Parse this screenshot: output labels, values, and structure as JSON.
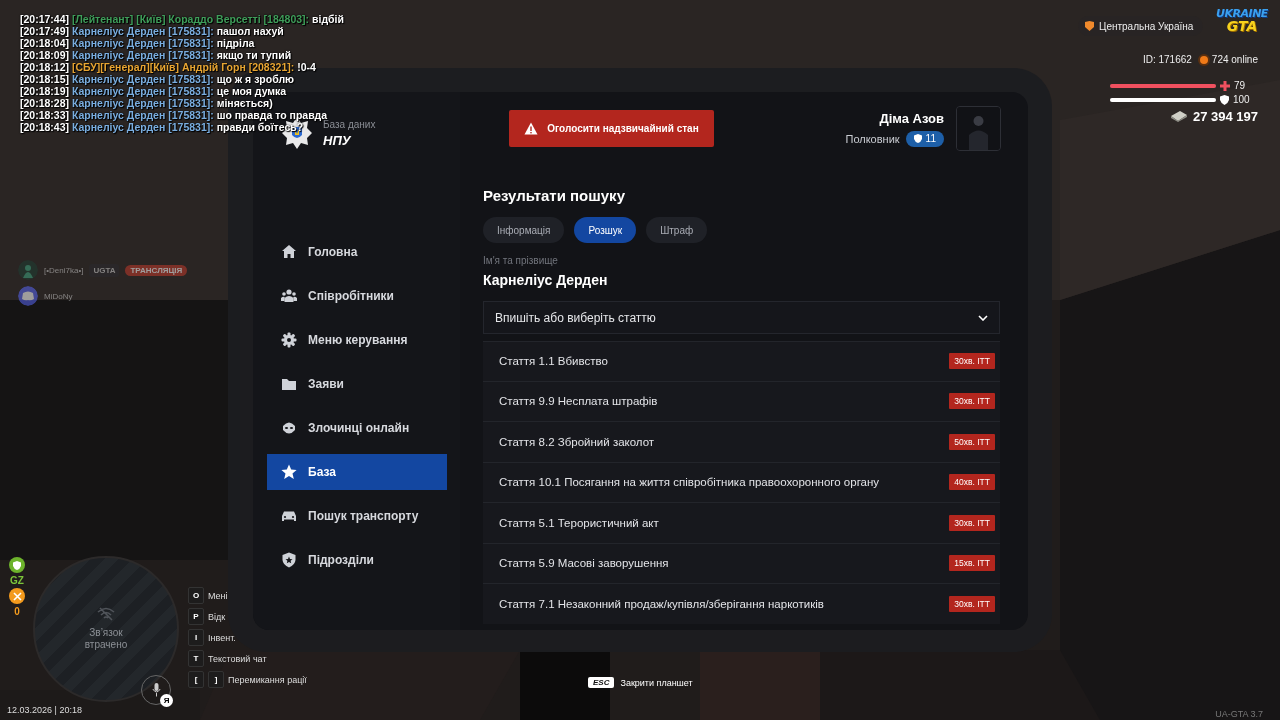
{
  "chat": [
    {
      "time": "[20:17:44]",
      "sender": "[Лейтенант] [Київ]  Кораддо Версетті [184803]:",
      "message": "відбій",
      "color": "#3f9e5a"
    },
    {
      "time": "[20:17:49]",
      "sender": "Карнеліус Дерден [175831]:",
      "message": "пашол нахуй",
      "color": "#7aaee0"
    },
    {
      "time": "[20:18:04]",
      "sender": "Карнеліус Дерден [175831]:",
      "message": "підріла",
      "color": "#7aaee0"
    },
    {
      "time": "[20:18:09]",
      "sender": "Карнеліус Дерден [175831]:",
      "message": "якщо ти тупий",
      "color": "#7aaee0"
    },
    {
      "time": "[20:18:12]",
      "sender": "[СБУ][Генерал][Київ] Андрій Горн [208321]:",
      "message": "!0-4",
      "color": "#e8a532"
    },
    {
      "time": "[20:18:15]",
      "sender": "Карнеліус Дерден [175831]:",
      "message": "що ж я зроблю",
      "color": "#7aaee0"
    },
    {
      "time": "[20:18:19]",
      "sender": "Карнеліус Дерден [175831]:",
      "message": "це моя думка",
      "color": "#7aaee0"
    },
    {
      "time": "[20:18:28]",
      "sender": "Карнеліус Дерден [175831]:",
      "message": "міняється)",
      "color": "#7aaee0"
    },
    {
      "time": "[20:18:33]",
      "sender": "Карнеліус Дерден [175831]:",
      "message": "шо правда то правда",
      "color": "#7aaee0"
    },
    {
      "time": "[20:18:43]",
      "sender": "Карнеліус Дерден [175831]:",
      "message": "правди боїтесь?",
      "color": "#7aaee0"
    }
  ],
  "hud": {
    "region": "Центральна Україна",
    "logo_top": "UKRAINE",
    "logo_bottom": "GTA",
    "id": "ID: 171662",
    "online": "724 online",
    "health": {
      "value": "79",
      "level": 1
    },
    "armor": {
      "value": "100",
      "level": 1
    },
    "money": "27 394 197"
  },
  "voice": [
    {
      "name": "[•Deni7ka•]",
      "tag": "UGTA",
      "badge": "ТРАНСЛЯЦІЯ"
    },
    {
      "name": "MiDoNy"
    }
  ],
  "status": {
    "zone": "GZ",
    "hunger": "0"
  },
  "minimap": {
    "message": "Зв’язок втрачено",
    "voice_badge": "Я"
  },
  "keybinds": [
    {
      "keys": [
        "O"
      ],
      "label": "Мені"
    },
    {
      "keys": [
        "P"
      ],
      "label": "Відк"
    },
    {
      "keys": [
        "I"
      ],
      "label": "Інвент."
    },
    {
      "keys": [
        "T"
      ],
      "label": "Текстовий чат"
    },
    {
      "keys": [
        "[",
        "]"
      ],
      "label": "Перемикання рації"
    }
  ],
  "datetime": "12.03.2026 | 20:18",
  "close_hint": {
    "key": "ESC",
    "label": "Закрити планшет"
  },
  "version": "UA-GTA 3.7",
  "tablet": {
    "brand": {
      "subtitle": "База даних",
      "title": "НПУ"
    },
    "emergency_button": "Оголосити надзвичайний стан",
    "user": {
      "name": "Діма Азов",
      "rank": "Полковник",
      "level": "11"
    },
    "nav": [
      {
        "label": "Головна",
        "kind": "home",
        "selected": false
      },
      {
        "label": "Співробітники",
        "kind": "people",
        "selected": false
      },
      {
        "label": "Меню керування",
        "kind": "gear",
        "selected": false
      },
      {
        "label": "Заяви",
        "kind": "folder",
        "selected": false
      },
      {
        "label": "Злочинці онлайн",
        "kind": "mask",
        "selected": false
      },
      {
        "label": "База",
        "kind": "star",
        "selected": true
      },
      {
        "label": "Пошук транспорту",
        "kind": "car",
        "selected": false
      },
      {
        "label": "Підрозділи",
        "kind": "shield",
        "selected": false
      }
    ],
    "title": "Результати пошуку",
    "tabs": [
      {
        "label": "Інформація",
        "selected": false
      },
      {
        "label": "Розшук",
        "selected": true
      },
      {
        "label": "Штраф",
        "selected": false
      }
    ],
    "name_field": {
      "label": "Ім'я та прізвище",
      "value": "Карнеліус Дерден"
    },
    "article_select": {
      "placeholder": "Впишіть або виберіть статтю"
    },
    "articles": [
      {
        "code": "Стаття 1.1",
        "title": "Вбивство",
        "penalty": "30хв. ІТТ"
      },
      {
        "code": "Стаття 9.9",
        "title": "Несплата штрафів",
        "penalty": "30хв. ІТТ"
      },
      {
        "code": "Стаття 8.2",
        "title": "Збройний заколот",
        "penalty": "50хв. ІТТ"
      },
      {
        "code": "Стаття 10.1",
        "title": "Посягання на життя співробітника правоохоронного органу",
        "penalty": "40хв. ІТТ"
      },
      {
        "code": "Стаття 5.1",
        "title": "Терористичний акт",
        "penalty": "30хв. ІТТ"
      },
      {
        "code": "Стаття 5.9",
        "title": "Масові заворушення",
        "penalty": "15хв. ІТТ"
      },
      {
        "code": "Стаття 7.1",
        "title": "Незаконний продаж/купівля/зберігання наркотиків",
        "penalty": "30хв. ІТТ"
      }
    ]
  }
}
